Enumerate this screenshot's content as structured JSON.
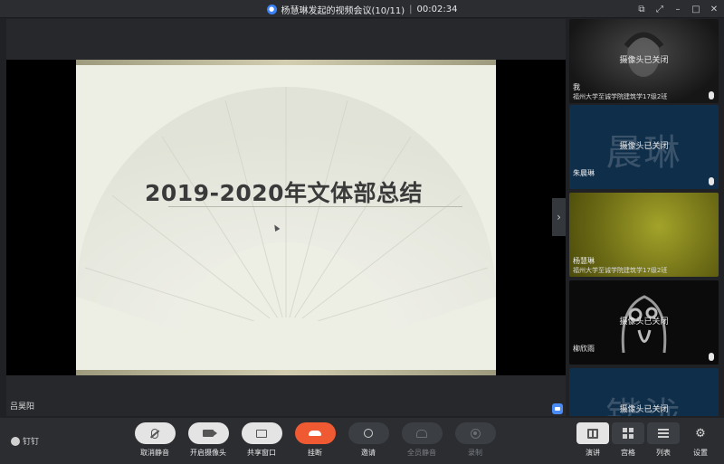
{
  "titlebar": {
    "title": "杨慧琳发起的视频会议(10/11)",
    "separator": "|",
    "timer": "00:02:34"
  },
  "slide": {
    "title": "2019-2020年文体部总结"
  },
  "stage": {
    "presenter_name": "吕昊阳"
  },
  "participants": [
    {
      "name": "我",
      "sub": "福州大学至诚学院建筑学17级2班",
      "status": "摄像头已关闭",
      "big": ""
    },
    {
      "name": "朱晨琳",
      "sub": "",
      "status": "摄像头已关闭",
      "big": "晨琳"
    },
    {
      "name": "杨慧琳",
      "sub": "福州大学至诚学院建筑学17级2班",
      "status": "",
      "big": ""
    },
    {
      "name": "柳欣雨",
      "sub": "",
      "status": "摄像头已关闭",
      "big": ""
    },
    {
      "name": "",
      "sub": "",
      "status": "摄像头已关闭",
      "big": "锴泷"
    }
  ],
  "toolbar": {
    "brand": "钉钉",
    "mute_label": "取消静音",
    "camera_label": "开启摄像头",
    "share_label": "共享窗口",
    "hangup_label": "挂断",
    "invite_label": "邀请",
    "mute_all_label": "全员静音",
    "record_label": "录制",
    "view_speaker_label": "演讲",
    "view_grid_label": "宫格",
    "view_list_label": "列表",
    "settings_label": "设置"
  },
  "colors": {
    "hangup": "#ef5a33",
    "accent": "#3b82f6",
    "tile_blue": "#0f2e4a"
  }
}
